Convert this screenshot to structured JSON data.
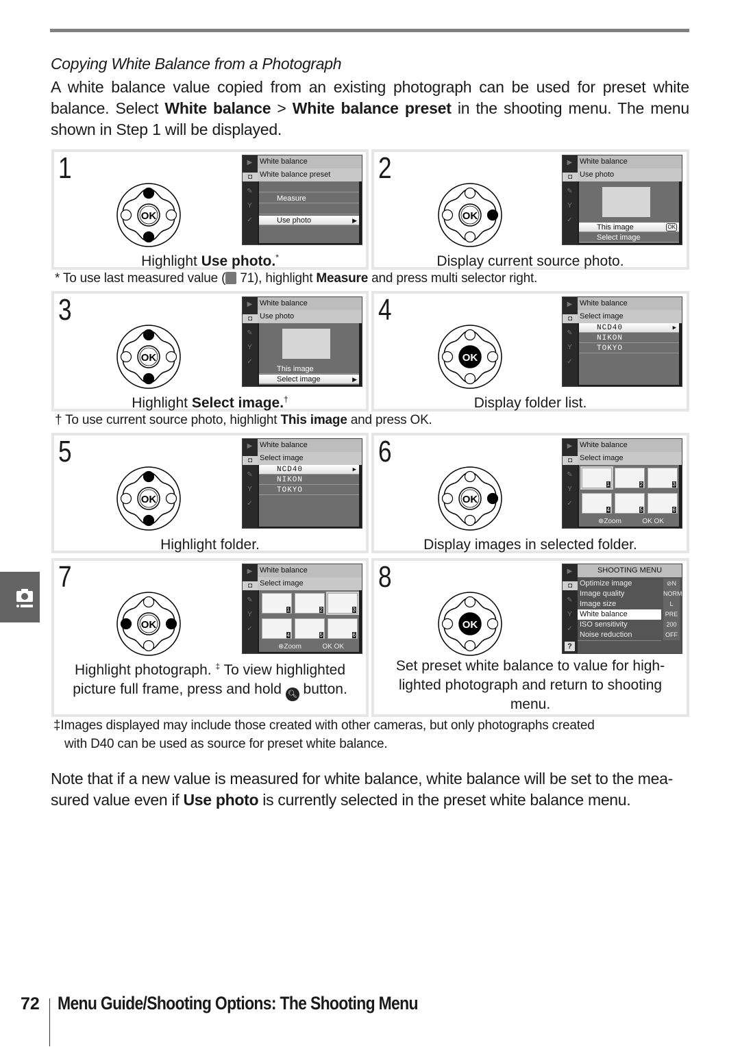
{
  "page": {
    "section_heading": "Copying White Balance from a Photograph",
    "intro": {
      "part1": "A white balance value copied from an existing photograph can be used for preset white balance.  Select ",
      "bold1": "White balance",
      "sep": " > ",
      "bold2": "White balance preset",
      "part2": " in the shooting menu.  The menu shown in Step 1 will be displayed."
    },
    "steps": [
      {
        "number": "1",
        "caption_pre": "Highlight ",
        "caption_bold": "Use photo.",
        "caption_mark": "*",
        "dial": {
          "up": true,
          "down": true,
          "left": false,
          "right": false,
          "ok": false
        },
        "screen": {
          "title": "White balance",
          "subtitle": "White balance preset",
          "rows": [
            {
              "label": "",
              "selected": false
            },
            {
              "label": "Measure",
              "selected": false
            },
            {
              "label": "",
              "selected": false
            },
            {
              "label": "Use photo",
              "selected": true,
              "arrow": "▶"
            }
          ]
        }
      },
      {
        "number": "2",
        "caption_pre": "Display current source photo.",
        "caption_bold": "",
        "caption_mark": "",
        "dial": {
          "up": false,
          "down": false,
          "left": false,
          "right": true,
          "ok": false
        },
        "screen": {
          "title": "White balance",
          "subtitle": "Use photo",
          "rows": [
            {
              "label": "This image",
              "selected": true,
              "badge": "OK"
            },
            {
              "label": "Select image",
              "selected": false
            }
          ]
        }
      },
      {
        "number": "3",
        "caption_pre": "Highlight ",
        "caption_bold": "Select image.",
        "caption_mark": "†",
        "dial": {
          "up": true,
          "down": true,
          "left": false,
          "right": false,
          "ok": false
        },
        "screen": {
          "title": "White balance",
          "subtitle": "Use photo",
          "rows": [
            {
              "label": "This image",
              "selected": false
            },
            {
              "label": "Select image",
              "selected": true,
              "arrow": "▶"
            }
          ]
        }
      },
      {
        "number": "4",
        "caption_pre": "Display folder list.",
        "caption_bold": "",
        "caption_mark": "",
        "dial": {
          "up": false,
          "down": false,
          "left": false,
          "right": false,
          "ok": true
        },
        "screen": {
          "title": "White balance",
          "subtitle": "Select image",
          "rows": [
            {
              "label": "NCD40",
              "selected": true,
              "arrow": "▶"
            },
            {
              "label": "NIKON",
              "selected": false
            },
            {
              "label": "TOKYO",
              "selected": false
            }
          ]
        }
      },
      {
        "number": "5",
        "caption_pre": "Highlight folder.",
        "caption_bold": "",
        "caption_mark": "",
        "dial": {
          "up": true,
          "down": true,
          "left": false,
          "right": false,
          "ok": false
        },
        "screen": {
          "title": "White balance",
          "subtitle": "Select image",
          "rows": [
            {
              "label": "NCD40",
              "selected": true,
              "arrow": "▶"
            },
            {
              "label": "NIKON",
              "selected": false
            },
            {
              "label": "TOKYO",
              "selected": false
            }
          ]
        }
      },
      {
        "number": "6",
        "caption_pre": "Display images in selected folder.",
        "caption_bold": "",
        "caption_mark": "",
        "dial": {
          "up": false,
          "down": false,
          "left": false,
          "right": true,
          "ok": false
        },
        "screen": {
          "title": "White balance",
          "subtitle": "Select image",
          "thumbnails": [
            "1",
            "2",
            "3",
            "4",
            "5",
            "6"
          ],
          "highlighted": 0,
          "zoom_label": "⊕Zoom",
          "ok_label": "OK OK"
        }
      },
      {
        "number": "7",
        "caption_line1": "Highlight photograph. ",
        "caption_mark": "‡",
        "caption_line1b": "  To view highlighted",
        "caption_line2a": "picture full frame, press and hold ",
        "caption_line2b": " button.",
        "dial": {
          "up": false,
          "down": false,
          "left": true,
          "right": true,
          "ok": false
        },
        "screen": {
          "title": "White balance",
          "subtitle": "Select image",
          "thumbnails": [
            "1",
            "2",
            "3",
            "4",
            "5",
            "6"
          ],
          "highlighted": 2,
          "zoom_label": "⊕Zoom",
          "ok_label": "OK OK"
        }
      },
      {
        "number": "8",
        "caption_line1": "Set preset white balance to value for high-",
        "caption_line2": "lighted photograph and return to shooting",
        "caption_line3": "menu.",
        "dial": {
          "up": false,
          "down": false,
          "left": false,
          "right": false,
          "ok": true
        },
        "screen": {
          "title": "SHOOTING MENU",
          "items": [
            {
              "label": "Optimize image",
              "value": "⊘N",
              "selected": false
            },
            {
              "label": "Image quality",
              "value": "NORM",
              "selected": false
            },
            {
              "label": "Image size",
              "value": "L",
              "selected": false
            },
            {
              "label": "White balance",
              "value": "PRE",
              "selected": true
            },
            {
              "label": "ISO sensitivity",
              "value": "200",
              "selected": false
            },
            {
              "label": "Noise reduction",
              "value": "OFF",
              "selected": false
            }
          ],
          "help": "?"
        }
      }
    ],
    "footnotes": {
      "star": {
        "pre": "* To use last measured value (",
        "ref": " 71), highlight ",
        "bold": "Measure",
        "post": " and press multi selector right."
      },
      "dagger": {
        "pre": "† To use current source photo, highlight ",
        "bold": "This image",
        "post": " and press OK."
      },
      "ddagger": {
        "line1": "‡Images displayed may include those created with other cameras, but only photographs created",
        "line2": "with D40 can be used as source for preset white balance."
      }
    },
    "note": {
      "pre": "Note that if a new value is measured for white balance, white balance will be set to the mea-sured value even if ",
      "bold": "Use photo",
      "post": " is currently selected in the preset white balance menu."
    },
    "ok_label": "OK",
    "footer": {
      "page_number": "72",
      "title": "Menu Guide/Shooting Options: The Shooting Menu"
    }
  }
}
